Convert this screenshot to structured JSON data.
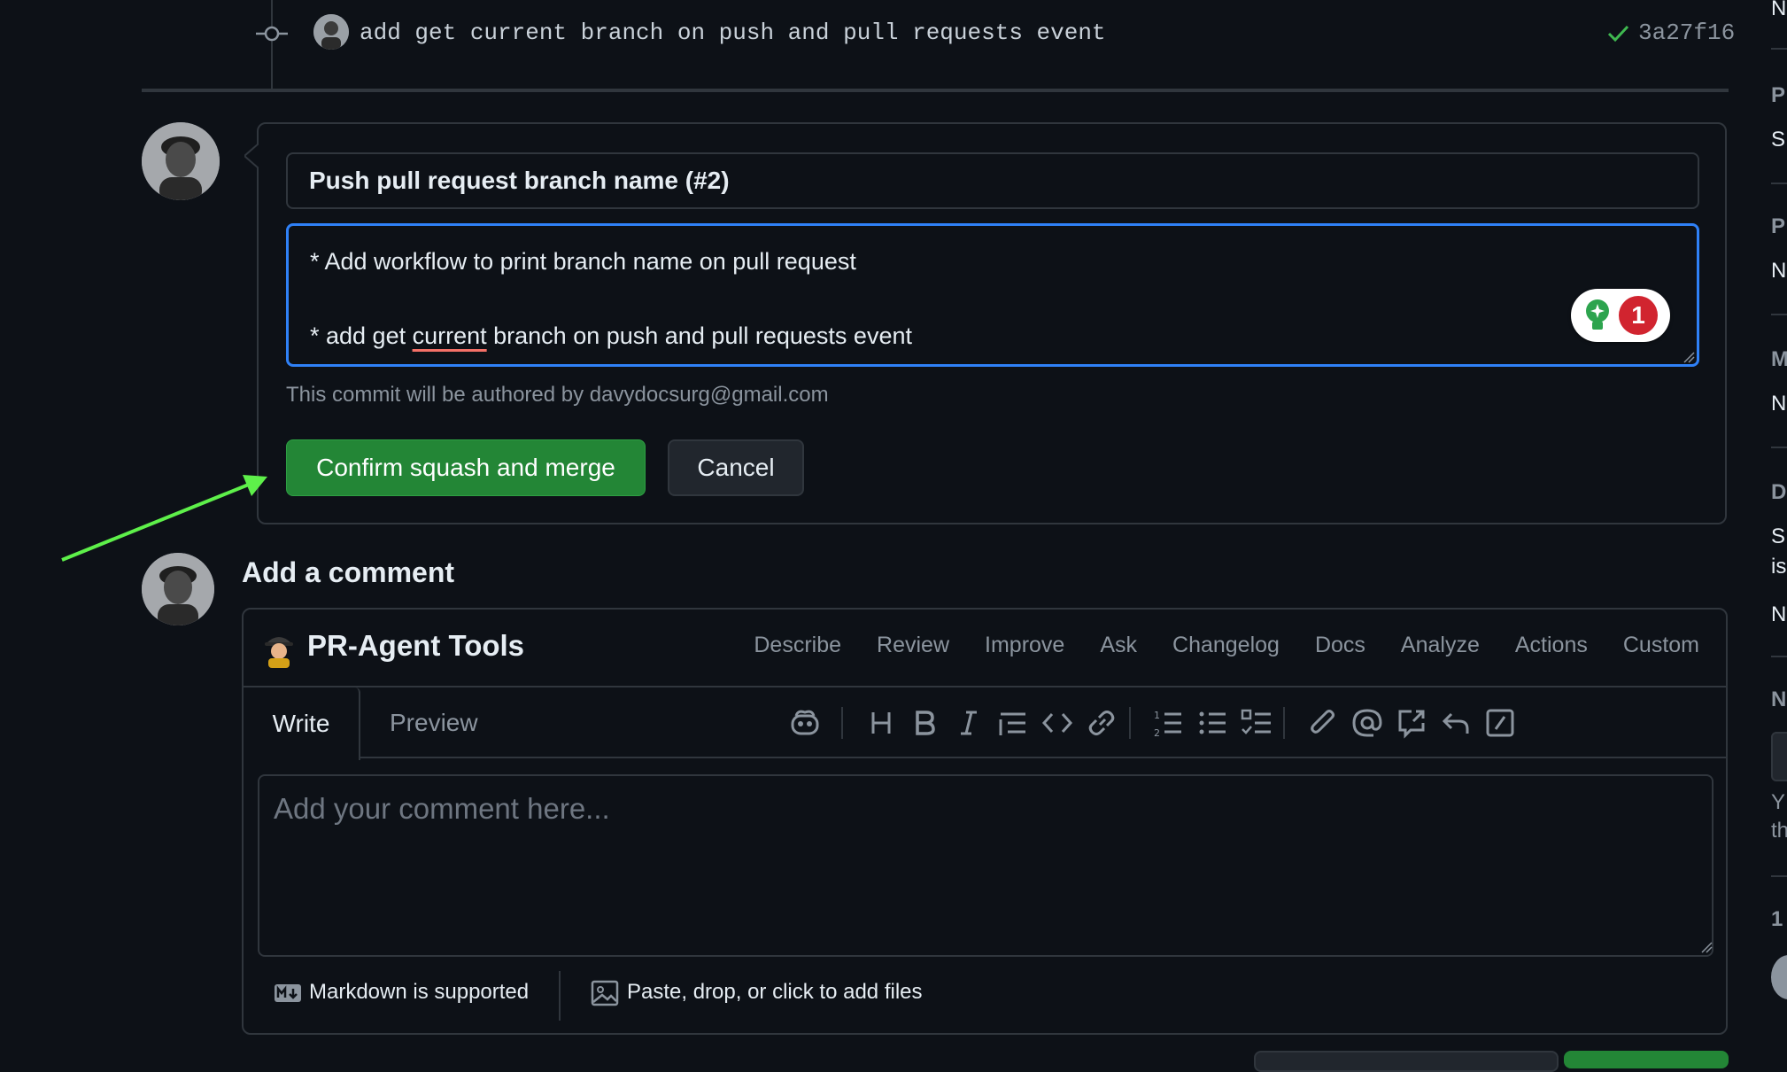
{
  "commit": {
    "message": "add get current branch on push and pull requests event",
    "sha": "3a27f16"
  },
  "merge": {
    "title_value": "Push pull request branch name (#2)",
    "body_line1": "* Add workflow to print branch name on pull request",
    "body_line2_prefix": "* add get ",
    "body_line2_flagged": "current",
    "body_line2_suffix": " branch on push and pull requests event",
    "grammar_count": "1",
    "author_note": "This commit will be authored by davydocsurg@gmail.com",
    "confirm_label": "Confirm squash and merge",
    "cancel_label": "Cancel"
  },
  "comment": {
    "heading": "Add a comment",
    "agent_title": "PR-Agent Tools",
    "agent_links": [
      "Describe",
      "Review",
      "Improve",
      "Ask",
      "Changelog",
      "Docs",
      "Analyze",
      "Actions",
      "Custom"
    ],
    "tab_write": "Write",
    "tab_preview": "Preview",
    "placeholder": "Add your comment here...",
    "markdown_label": "Markdown is supported",
    "files_label": "Paste, drop, or click to add files"
  },
  "sidebar_letters": [
    {
      "text": "N",
      "kind": "text"
    },
    {
      "text": "P",
      "kind": "head"
    },
    {
      "text": "S",
      "kind": "text"
    },
    {
      "text": "P",
      "kind": "head"
    },
    {
      "text": "N",
      "kind": "text"
    },
    {
      "text": "M",
      "kind": "head"
    },
    {
      "text": "N",
      "kind": "text"
    },
    {
      "text": "D",
      "kind": "head"
    },
    {
      "text": "S",
      "kind": "text"
    },
    {
      "text": "is",
      "kind": "text"
    },
    {
      "text": "N",
      "kind": "text"
    },
    {
      "text": "N",
      "kind": "head"
    },
    {
      "text": "Y",
      "kind": "text"
    },
    {
      "text": "th",
      "kind": "text"
    },
    {
      "text": "1",
      "kind": "head"
    }
  ],
  "colors": {
    "background": "#0d1117",
    "border": "#30363d",
    "primary_green": "#238636",
    "focus_blue": "#2f81f7",
    "arrow_green": "#5ef04a",
    "badge_red": "#d1242f"
  }
}
